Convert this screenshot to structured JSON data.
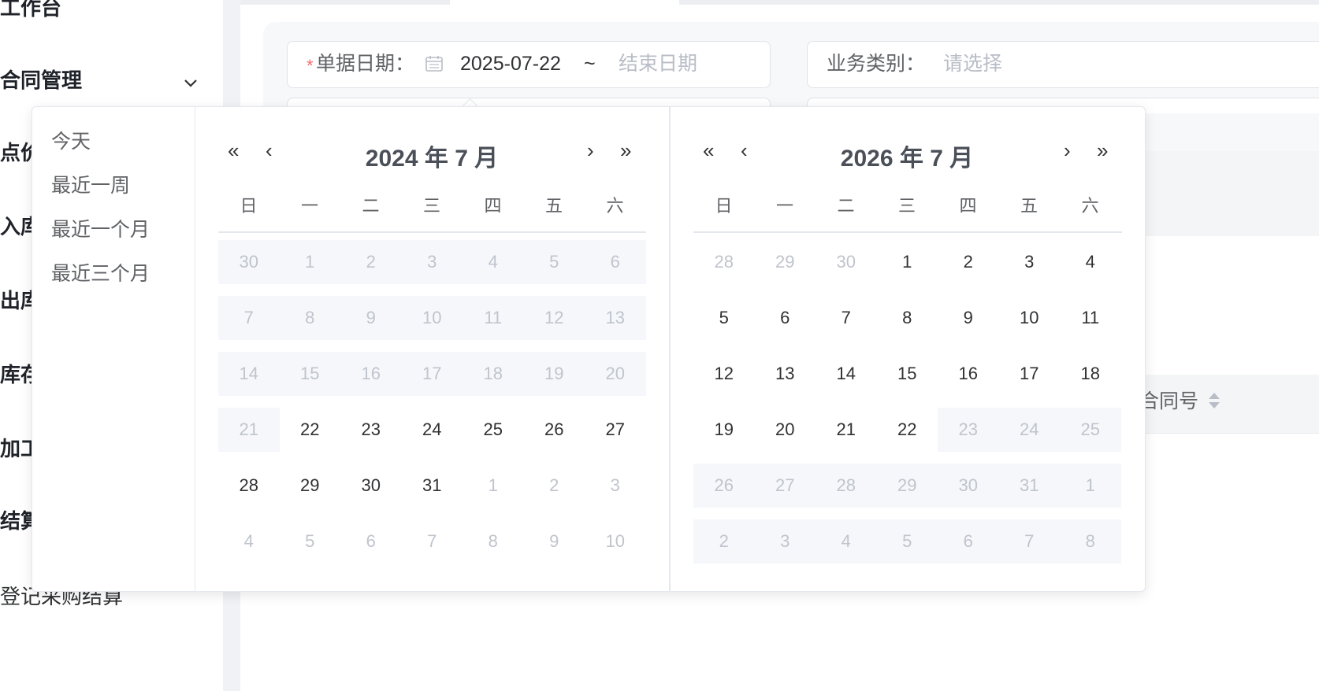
{
  "sidebar": {
    "items": [
      {
        "label": "工作台"
      },
      {
        "label": "合同管理"
      },
      {
        "label": "点价"
      },
      {
        "label": "入库"
      },
      {
        "label": "出库"
      },
      {
        "label": "库存"
      },
      {
        "label": "加工"
      },
      {
        "label": "结算"
      },
      {
        "label": "登记采购结算"
      }
    ]
  },
  "search": {
    "date_label": "单据日期：",
    "required_mark": "*",
    "start_date": "2025-07-22",
    "separator": "~",
    "end_placeholder": "结束日期",
    "biz_label": "业务类别：",
    "biz_placeholder": "请选择"
  },
  "table": {
    "contract_no_header": "合同号"
  },
  "picker": {
    "shortcuts": [
      "今天",
      "最近一周",
      "最近一个月",
      "最近三个月"
    ],
    "weekdays": [
      "日",
      "一",
      "二",
      "三",
      "四",
      "五",
      "六"
    ],
    "left": {
      "title": "2024 年 7 月",
      "days": [
        [
          "30",
          "1",
          "2",
          "3",
          "4",
          "5",
          "6"
        ],
        [
          "7",
          "8",
          "9",
          "10",
          "11",
          "12",
          "13"
        ],
        [
          "14",
          "15",
          "16",
          "17",
          "18",
          "19",
          "20"
        ],
        [
          "21",
          "22",
          "23",
          "24",
          "25",
          "26",
          "27"
        ],
        [
          "28",
          "29",
          "30",
          "31",
          "1",
          "2",
          "3"
        ],
        [
          "4",
          "5",
          "6",
          "7",
          "8",
          "9",
          "10"
        ]
      ],
      "state": [
        [
          "d",
          "d",
          "d",
          "d",
          "d",
          "d",
          "d"
        ],
        [
          "d",
          "d",
          "d",
          "d",
          "d",
          "d",
          "d"
        ],
        [
          "d",
          "d",
          "d",
          "d",
          "d",
          "d",
          "d"
        ],
        [
          "d",
          "n",
          "n",
          "n",
          "n",
          "n",
          "n"
        ],
        [
          "n",
          "n",
          "n",
          "n",
          "o",
          "o",
          "o"
        ],
        [
          "o",
          "o",
          "o",
          "o",
          "o",
          "o",
          "o"
        ]
      ]
    },
    "right": {
      "title": "2026 年 7 月",
      "days": [
        [
          "28",
          "29",
          "30",
          "1",
          "2",
          "3",
          "4"
        ],
        [
          "5",
          "6",
          "7",
          "8",
          "9",
          "10",
          "11"
        ],
        [
          "12",
          "13",
          "14",
          "15",
          "16",
          "17",
          "18"
        ],
        [
          "19",
          "20",
          "21",
          "22",
          "23",
          "24",
          "25"
        ],
        [
          "26",
          "27",
          "28",
          "29",
          "30",
          "31",
          "1"
        ],
        [
          "2",
          "3",
          "4",
          "5",
          "6",
          "7",
          "8"
        ]
      ],
      "state": [
        [
          "o",
          "o",
          "o",
          "n",
          "n",
          "n",
          "n"
        ],
        [
          "n",
          "n",
          "n",
          "n",
          "n",
          "n",
          "n"
        ],
        [
          "n",
          "n",
          "n",
          "n",
          "n",
          "n",
          "n"
        ],
        [
          "n",
          "n",
          "n",
          "n",
          "d",
          "d",
          "d"
        ],
        [
          "d",
          "d",
          "d",
          "d",
          "d",
          "d",
          "d"
        ],
        [
          "d",
          "d",
          "d",
          "d",
          "d",
          "d",
          "d"
        ]
      ]
    },
    "nav": {
      "prev_year": "«",
      "prev_month": "‹",
      "next_month": "›",
      "next_year": "»"
    }
  }
}
